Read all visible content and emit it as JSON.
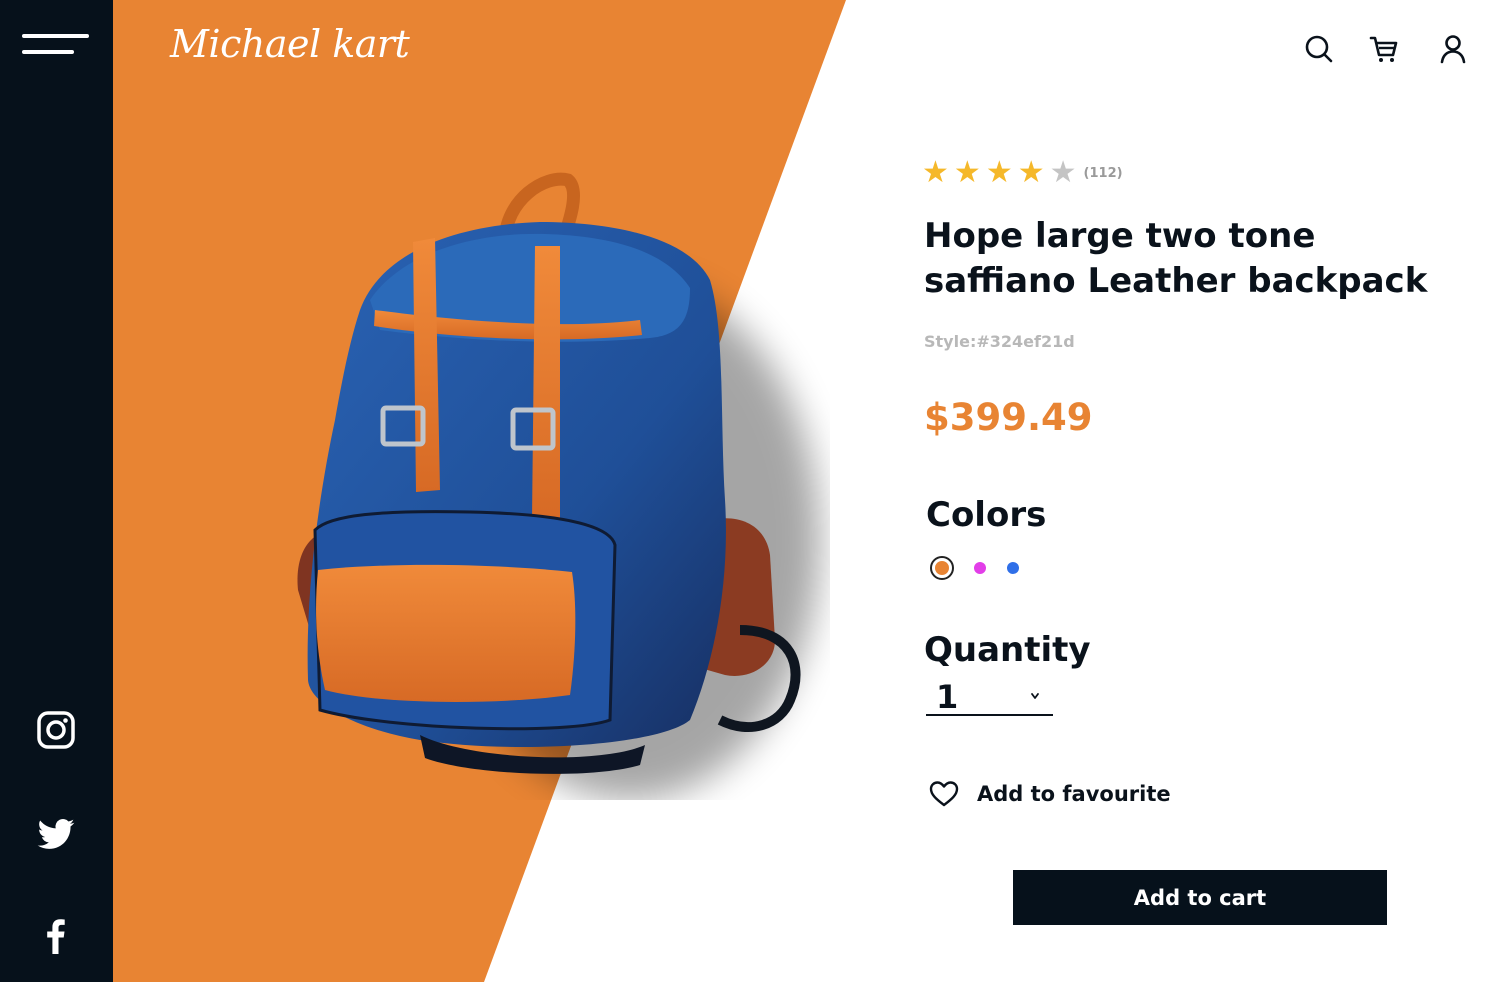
{
  "brand": {
    "logo_text": "Michael kart"
  },
  "header_icons": [
    "search-icon",
    "cart-icon",
    "user-icon"
  ],
  "sidebar": {
    "social_icons": [
      "instagram-icon",
      "twitter-icon",
      "facebook-icon"
    ]
  },
  "product": {
    "image_subject": "blue canvas backpack with tan leather straps",
    "rating": 4,
    "rating_max": 5,
    "review_count": "(112)",
    "title": "Hope large two tone saffiano Leather backpack",
    "style_code": "Style:#324ef21d",
    "price": "$399.49"
  },
  "colors": {
    "heading": "Colors",
    "options": [
      "#e88433",
      "#e23ee8",
      "#2f6fe8"
    ],
    "selected_index": 0
  },
  "quantity": {
    "heading": "Quantity",
    "value": "1"
  },
  "favourite": {
    "label": "Add to favourite"
  },
  "cart": {
    "button_label": "Add to cart"
  },
  "theme": {
    "accent": "#e88433",
    "dark": "#06111b",
    "star": "#f5b82a",
    "star_empty": "#c4c4c4"
  }
}
